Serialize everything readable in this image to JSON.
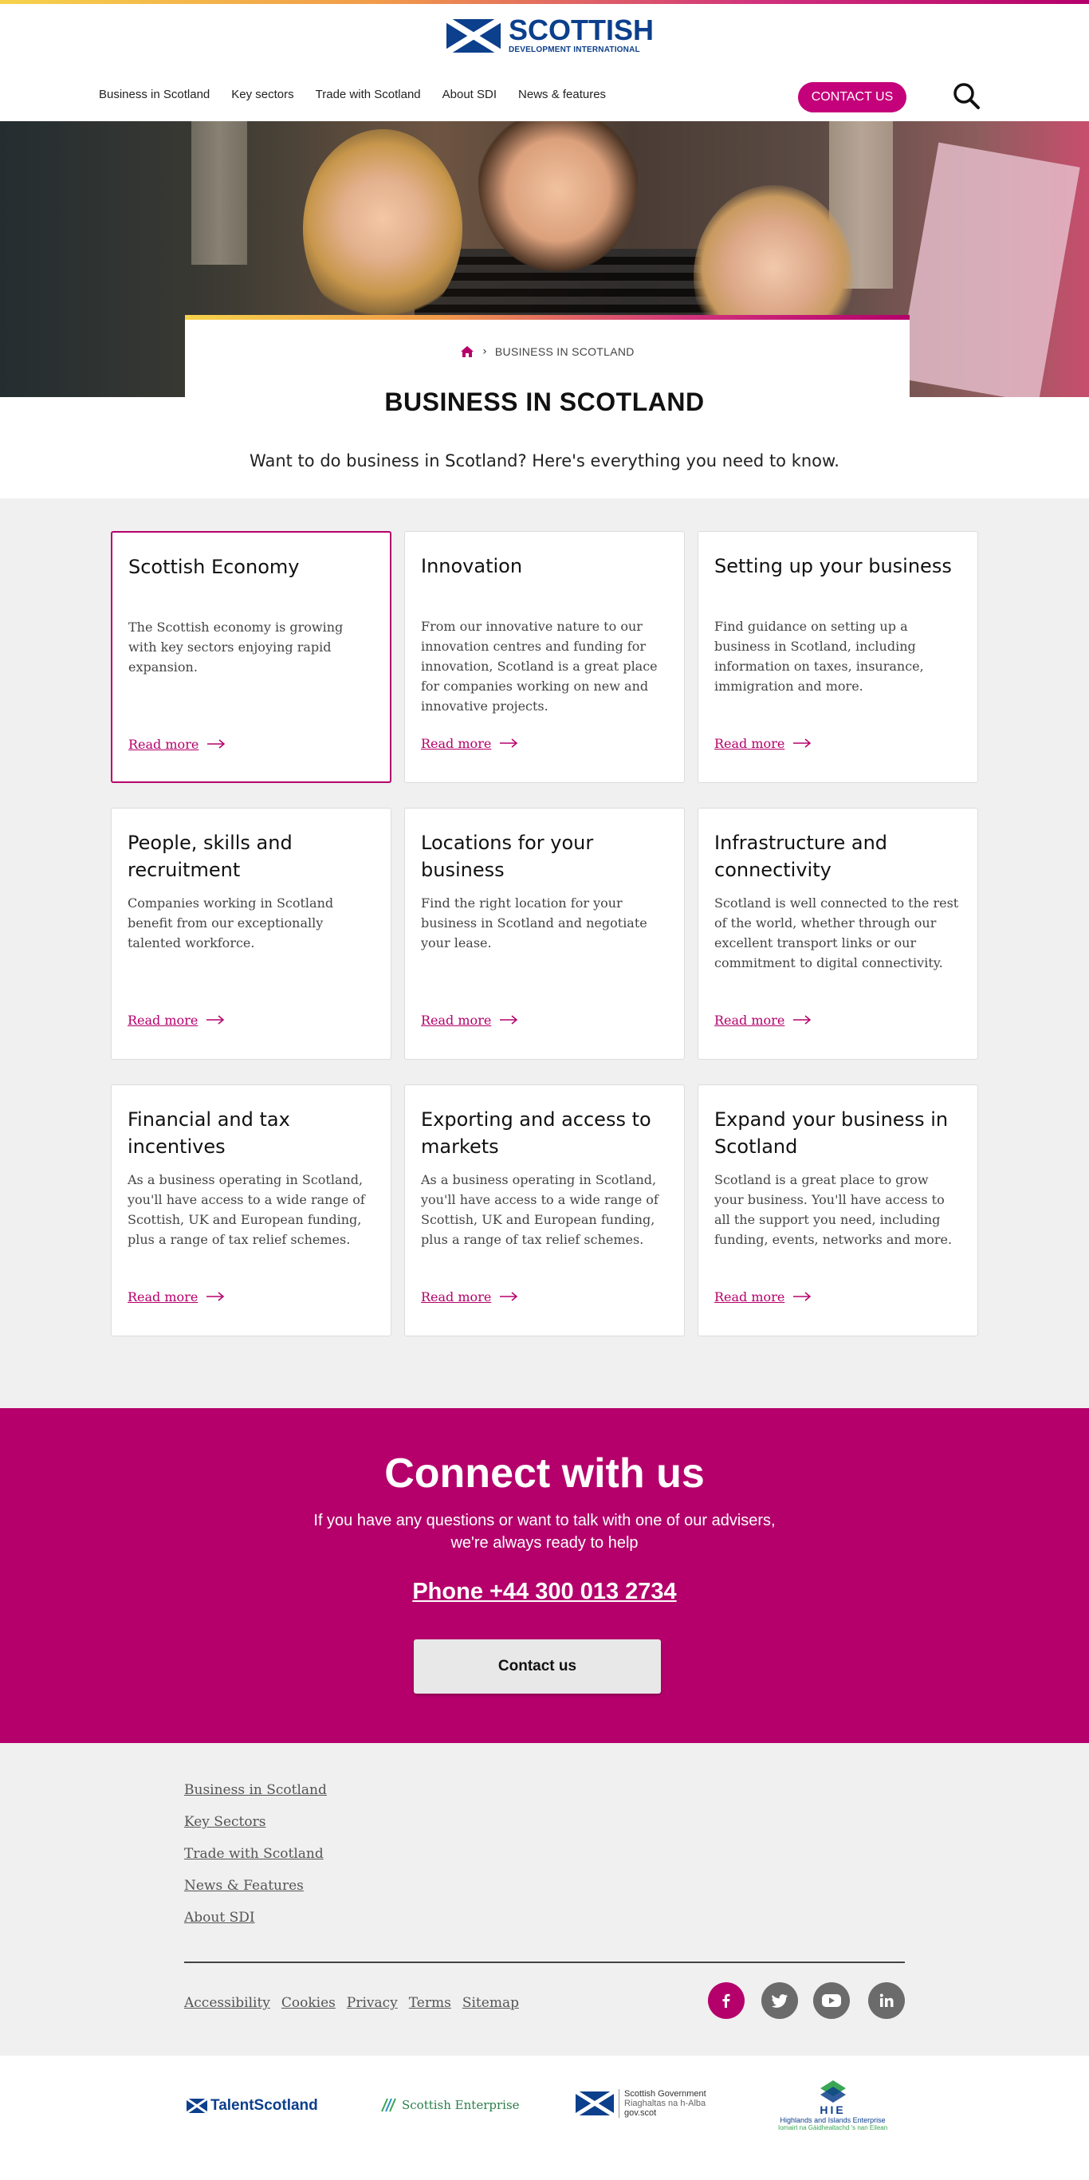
{
  "brand": {
    "name": "SCOTTISH",
    "subtitle": "DEVELOPMENT INTERNATIONAL"
  },
  "nav": {
    "items": [
      "Business in Scotland",
      "Key sectors",
      "Trade with Scotland",
      "About SDI",
      "News & features"
    ],
    "contact_label": "CONTACT US"
  },
  "breadcrumb": {
    "current": "BUSINESS IN SCOTLAND"
  },
  "page": {
    "title": "BUSINESS IN SCOTLAND",
    "intro": "Want to do business in Scotland? Here's everything you need to know."
  },
  "cards": [
    {
      "title": "Scottish Economy",
      "text": "The Scottish economy is growing with key sectors enjoying rapid expansion.",
      "link": "Read more"
    },
    {
      "title": "Innovation",
      "text": "From our innovative nature to our innovation centres and funding for innovation, Scotland is a great place for companies working on new and innovative projects.",
      "link": "Read more"
    },
    {
      "title": "Setting up your business",
      "text": "Find guidance on setting up a business in Scotland, including information on taxes, insurance, immigration and more.",
      "link": "Read more"
    },
    {
      "title": "People, skills and recruitment",
      "text": "Companies working in Scotland benefit from our exceptionally talented workforce.",
      "link": "Read more"
    },
    {
      "title": "Locations for your business",
      "text": "Find the right location for your business in Scotland and negotiate your lease.",
      "link": "Read more"
    },
    {
      "title": "Infrastructure and connectivity",
      "text": "Scotland is well connected to the rest of the world, whether through our excellent transport links or our commitment to digital connectivity.",
      "link": "Read more"
    },
    {
      "title": "Financial and tax incentives",
      "text": "As a business operating in Scotland, you'll have access to a wide range of Scottish, UK and European funding, plus a range of tax relief schemes.",
      "link": "Read more"
    },
    {
      "title": "Exporting and access to markets",
      "text": "As a business operating in Scotland, you'll have access to a wide range of Scottish, UK and European funding, plus a range of tax relief schemes.",
      "link": "Read more"
    },
    {
      "title": "Expand your business in Scotland",
      "text": "Scotland is a great place to grow your business. You'll have access to all the support you need, including funding, events, networks and more.",
      "link": "Read more"
    }
  ],
  "connect": {
    "title": "Connect with us",
    "line1": "If you have any questions or want to talk with one of our advisers,",
    "line2": "we're always ready to help",
    "phone": "Phone  +44 300 013 2734",
    "button": "Contact us"
  },
  "footer": {
    "links": [
      "Business in Scotland",
      "Key Sectors",
      "Trade with Scotland",
      "News & Features",
      "About SDI"
    ],
    "legal": [
      "Accessibility",
      "Cookies",
      "Privacy",
      "Terms",
      "Sitemap"
    ],
    "social_icons": [
      "facebook-icon",
      "twitter-icon",
      "youtube-icon",
      "linkedin-icon"
    ]
  },
  "partners": {
    "talent": "TalentScotland",
    "enterprise": "Scottish Enterprise",
    "gov_line1": "Scottish Government",
    "gov_line2": "Riaghaltas na h-Alba",
    "gov_line3": "gov.scot",
    "hie_short": "HIE",
    "hie_line1": "Highlands and Islands Enterprise",
    "hie_line2": "Iomairt na Gàidhealtachd 's nan Eilean"
  },
  "colors": {
    "accent": "#b5006b",
    "contact_button": "#c4007a",
    "brand_blue": "#0c3f8c",
    "cards_bg": "#f0f0f0"
  }
}
